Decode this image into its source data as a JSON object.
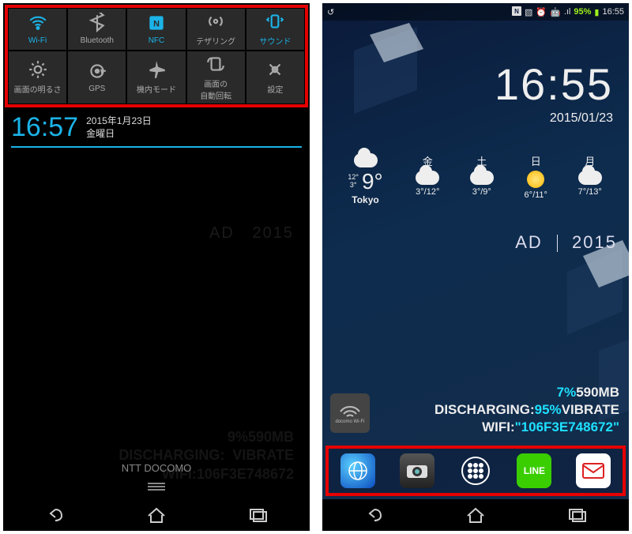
{
  "left": {
    "toggles": [
      {
        "label": "Wi-Fi",
        "active": true
      },
      {
        "label": "Bluetooth",
        "active": false
      },
      {
        "label": "NFC",
        "active": true
      },
      {
        "label": "テザリング",
        "active": false
      },
      {
        "label": "サウンド",
        "active": true
      },
      {
        "label": "画面の明るさ",
        "active": false
      },
      {
        "label": "GPS",
        "active": false
      },
      {
        "label": "機内モード",
        "active": false
      },
      {
        "label": "画面の\n自動回転",
        "active": false
      },
      {
        "label": "設定",
        "active": false
      }
    ],
    "clock": {
      "time": "16:57",
      "date_line1": "2015年1月23日",
      "date_line2": "金曜日"
    },
    "dim": {
      "ad": "AD",
      "year": "2015",
      "pct": "9%",
      "mb": "590MB",
      "discharging": "DISCHARGING:",
      "vibrate": "VIBRATE",
      "wifi": "WIFI:",
      "mac": "106F3E748672"
    },
    "carrier": "NTT DOCOMO",
    "handle": "≡"
  },
  "right": {
    "status": {
      "back_icon": "↺",
      "battery_pct": "95%",
      "time": "16:55",
      "signal": ".ıl"
    },
    "clock": {
      "time": "16:55",
      "date": "2015/01/23"
    },
    "weather": {
      "now": {
        "temp": "9°",
        "lows": "12°",
        "lows2": "3°",
        "city": "Tokyo"
      },
      "forecast": [
        {
          "day": "金",
          "temp": "3°/12°",
          "icon": "cloud"
        },
        {
          "day": "土",
          "temp": "3°/9°",
          "icon": "cloud"
        },
        {
          "day": "日",
          "temp": "6°/11°",
          "icon": "sun"
        },
        {
          "day": "月",
          "temp": "7°/13°",
          "icon": "cloud"
        }
      ]
    },
    "ad": {
      "label": "AD",
      "year": "2015"
    },
    "docomo": {
      "label": "docomo Wi-Fi"
    },
    "stats": {
      "pct": "7%",
      "mb": "590MB",
      "discharging": "DISCHARGING:",
      "disch_pct": "95%",
      "vibrate": "VIBRATE",
      "wifi": "WIFI:",
      "mac": "\"106F3E748672\""
    },
    "dock": [
      "browser",
      "camera",
      "apps",
      "line",
      "mail"
    ]
  }
}
